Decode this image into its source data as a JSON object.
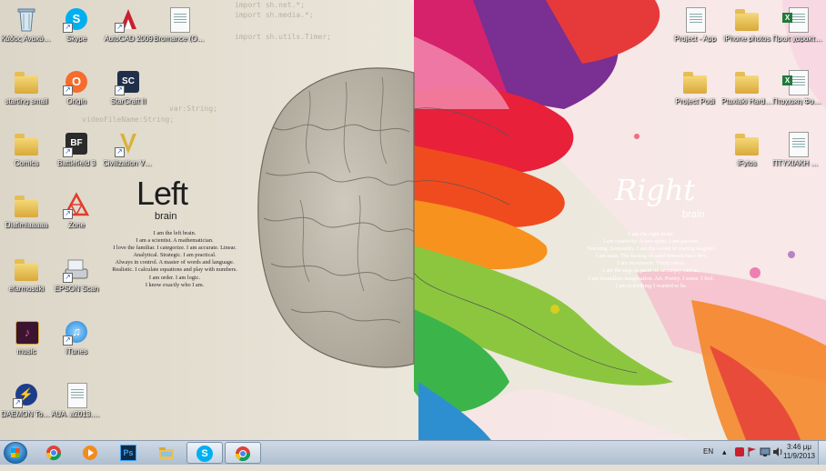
{
  "wallpaper": {
    "code_lines": [
      "import sh.net.*;",
      "import sh.media.*;",
      "import sh.utils.Timer;",
      "videoFileName:String;",
      "var:String;"
    ],
    "left": {
      "title": "Left",
      "subtitle": "brain",
      "lines": [
        "I am the left brain.",
        "I am a scientist. A mathematician.",
        "I love the familiar. I categorize. I am accurate. Linear.",
        "Analytical. Strategic. I am practical.",
        "Always in control. A master of words and language.",
        "Realistic. I calculate equations and play with numbers.",
        "I am order. I am logic.",
        "I know exactly who I am."
      ]
    },
    "right": {
      "title": "Right",
      "subtitle": "brain",
      "lines": [
        "I am the right brain.",
        "I am creativity. A free spirit. I am passion.",
        "Yearning. Sensuality. I am the sound of roaring laughter.",
        "I am taste. The feeling of sand beneath bare feet.",
        "I am movement. Vivid colors.",
        "I am the urge to paint on an empty canvas.",
        "I am boundless imagination. Art. Poetry. I sense. I feel.",
        "I am everything I wanted to be."
      ]
    }
  },
  "desktop_icons": [
    {
      "label": "Κάδος Ανακύκλωσης",
      "icon": "recycle-bin-icon"
    },
    {
      "label": "Skype",
      "icon": "skype-icon"
    },
    {
      "label": "AutoCAD 2009",
      "icon": "autocad-icon"
    },
    {
      "label": "Bromance (Official Mus...",
      "icon": "mp3-file-icon"
    },
    {
      "label": "starting small",
      "icon": "folder-icon"
    },
    {
      "label": "Origin",
      "icon": "origin-icon"
    },
    {
      "label": "StarCraft II",
      "icon": "starcraft-icon"
    },
    {
      "label": "Comics",
      "icon": "folder-icon"
    },
    {
      "label": "Battlefield 3",
      "icon": "battlefield-icon"
    },
    {
      "label": "Civilization V - Συντόμευση",
      "icon": "civilization-icon"
    },
    {
      "label": "Diafimiaaaaa",
      "icon": "folder-icon"
    },
    {
      "label": "Zone",
      "icon": "zone-icon"
    },
    {
      "label": "efarmostiki",
      "icon": "folder-icon"
    },
    {
      "label": "EPSON Scan",
      "icon": "scanner-icon"
    },
    {
      "label": "music",
      "icon": "music-folder-icon"
    },
    {
      "label": "iTunes",
      "icon": "itunes-icon"
    },
    {
      "label": "DAEMON Tools Lite",
      "icon": "daemon-tools-icon"
    },
    {
      "label": "AUA_a2013.sept",
      "icon": "document-icon"
    },
    {
      "label": "Project - App",
      "icon": "document-icon"
    },
    {
      "label": "iPhone photos",
      "icon": "folder-icon"
    },
    {
      "label": "Πρωτ χαρακτηριστ...",
      "icon": "excel-icon"
    },
    {
      "label": "Project Podi",
      "icon": "folder-icon"
    },
    {
      "label": "Ptuxiaki Hardcore",
      "icon": "folder-icon"
    },
    {
      "label": "Πτυχιακη Φυτος",
      "icon": "excel-icon"
    },
    {
      "label": "iFytos",
      "icon": "folder-icon"
    },
    {
      "label": "ΠΤΥΧΙΑΚΗ DOC",
      "icon": "document-icon"
    }
  ],
  "taskbar": {
    "start": "start-orb-icon",
    "pinned": [
      {
        "name": "chrome-icon",
        "active": false
      },
      {
        "name": "media-player-icon",
        "active": false
      },
      {
        "name": "photoshop-icon",
        "label": "Ps",
        "active": false
      },
      {
        "name": "explorer-icon",
        "active": false
      },
      {
        "name": "skype-icon",
        "active": true
      },
      {
        "name": "chrome-icon",
        "active": true
      }
    ],
    "language": "EN",
    "time": "3:46 μμ",
    "date": "11/9/2013"
  },
  "colors": {
    "taskbar": "#b9c8d8",
    "photoshop": "#0e2a47",
    "skype": "#00aff0",
    "chrome_red": "#db4437",
    "chrome_yellow": "#f4c20d",
    "chrome_green": "#0f9d58",
    "chrome_blue": "#4285f4"
  }
}
